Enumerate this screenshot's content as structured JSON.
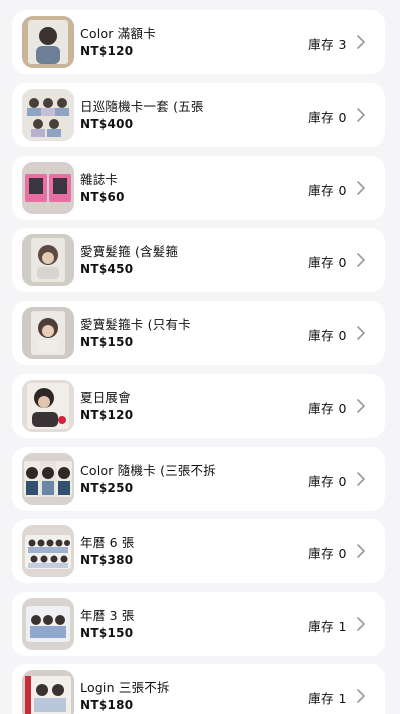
{
  "products": [
    {
      "title": "Color 滿額卡",
      "price": "NT$120",
      "stock": "庫存 3",
      "thumbnail": "photocard-portrait"
    },
    {
      "title": "日巡隨機卡一套 (五張",
      "price": "NT$400",
      "stock": "庫存 0",
      "thumbnail": "photocard-set"
    },
    {
      "title": "雜誌卡",
      "price": "NT$60",
      "stock": "庫存 0",
      "thumbnail": "magazine-cards"
    },
    {
      "title": "愛寶髮箍 (含髮箍",
      "price": "NT$450",
      "stock": "庫存 0",
      "thumbnail": "headband-card"
    },
    {
      "title": "愛寶髮箍卡 (只有卡",
      "price": "NT$150",
      "stock": "庫存 0",
      "thumbnail": "headband-card"
    },
    {
      "title": "夏日展會",
      "price": "NT$120",
      "stock": "庫存 0",
      "thumbnail": "photocard-portrait"
    },
    {
      "title": "Color 隨機卡 (三張不拆",
      "price": "NT$250",
      "stock": "庫存 0",
      "thumbnail": "photocard-set"
    },
    {
      "title": "年曆 6 張",
      "price": "NT$380",
      "stock": "庫存 0",
      "thumbnail": "calendar-cards"
    },
    {
      "title": "年曆 3 張",
      "price": "NT$150",
      "stock": "庫存 1",
      "thumbnail": "calendar-cards"
    },
    {
      "title": "Login 三張不拆",
      "price": "NT$180",
      "stock": "庫存 1",
      "thumbnail": "photocard-set"
    }
  ],
  "colors": {
    "background": "#f5f5f7",
    "card": "#ffffff",
    "text": "#111111",
    "chevron": "#9a9a9a"
  }
}
